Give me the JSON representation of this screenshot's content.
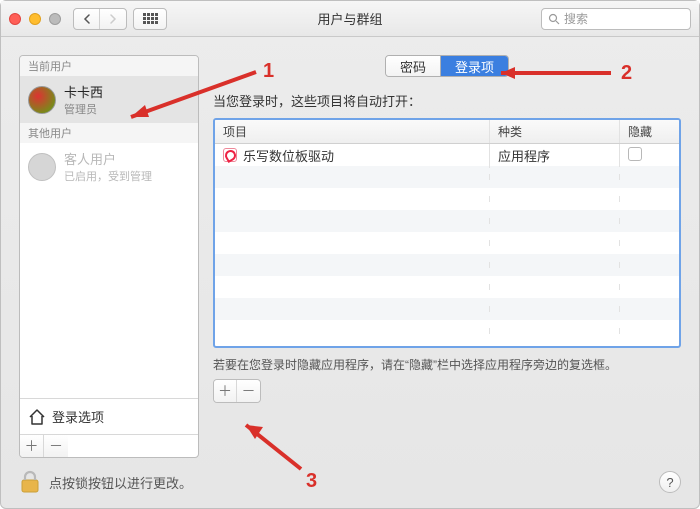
{
  "window": {
    "title": "用户与群组"
  },
  "search": {
    "placeholder": "搜索"
  },
  "sidebar": {
    "current_header": "当前用户",
    "other_header": "其他用户",
    "current_user": {
      "name": "卡卡西",
      "role": "管理员"
    },
    "guest_user": {
      "name": "客人用户",
      "role": "已启用，受到管理"
    },
    "login_options_label": "登录选项"
  },
  "tabs": {
    "password": "密码",
    "login_items": "登录项"
  },
  "caption": "当您登录时，这些项目将自动打开：",
  "columns": {
    "item": "项目",
    "kind": "种类",
    "hide": "隐藏"
  },
  "rows": [
    {
      "name": "乐写数位板驱动",
      "kind": "应用程序"
    }
  ],
  "hint": "若要在您登录时隐藏应用程序，请在“隐藏”栏中选择应用程序旁边的复选框。",
  "lock_text": "点按锁按钮以进行更改。",
  "annotations": {
    "a1": "1",
    "a2": "2",
    "a3": "3"
  }
}
